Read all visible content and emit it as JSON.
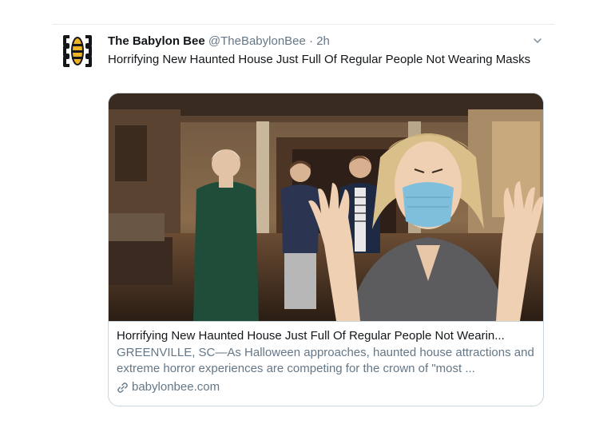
{
  "tweet": {
    "author_name": "The Babylon Bee",
    "author_handle": "@TheBabylonBee",
    "separator": "·",
    "time": "2h",
    "text": "Horrifying New Haunted House Just Full Of Regular People Not Wearing Masks"
  },
  "card": {
    "title": "Horrifying New Haunted House Just Full Of Regular People Not Wearin...",
    "description": "GREENVILLE, SC—As Halloween approaches, haunted house attractions and extreme horror experiences are competing for the crown of \"most ...",
    "domain": "babylonbee.com"
  },
  "icons": {
    "avatar": "babylon-bee-logo",
    "menu": "chevron-down-icon",
    "link": "link-icon"
  },
  "colors": {
    "text_primary": "#14171a",
    "text_secondary": "#657786",
    "border": "#ccd6dd",
    "logo_gold": "#f0b323"
  }
}
